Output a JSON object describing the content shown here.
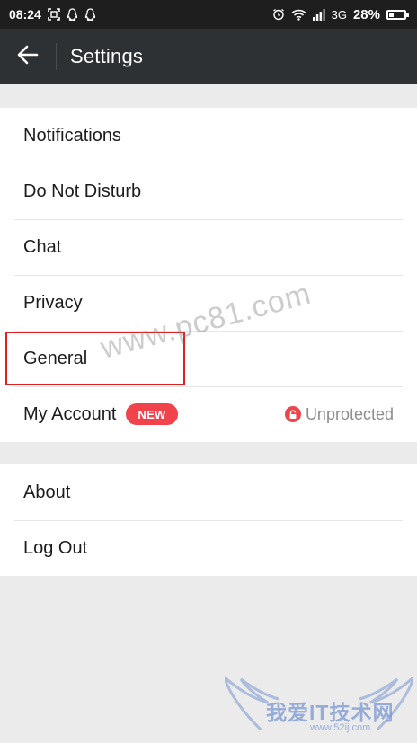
{
  "status_bar": {
    "time": "08:24",
    "network": "3G",
    "battery": "28%",
    "icons": [
      "screenshot-icon",
      "qq-icon",
      "qq-icon",
      "alarm-icon",
      "wifi-icon",
      "signal-icon",
      "battery-icon"
    ]
  },
  "toolbar": {
    "title": "Settings",
    "back_icon": "arrow-left-icon"
  },
  "section1": {
    "items": [
      {
        "label": "Notifications"
      },
      {
        "label": "Do Not Disturb"
      },
      {
        "label": "Chat"
      },
      {
        "label": "Privacy"
      },
      {
        "label": "General",
        "highlighted": true
      },
      {
        "label": "My Account",
        "badge": "NEW",
        "status": "Unprotected",
        "status_icon": "lock-icon"
      }
    ]
  },
  "section2": {
    "items": [
      {
        "label": "About"
      },
      {
        "label": "Log Out"
      }
    ]
  },
  "watermarks": {
    "text": "www.pc81.com",
    "logo_text": "我爱IT技术网",
    "logo_url": "www.52ij.com"
  },
  "colors": {
    "toolbar": "#2e3133",
    "statusbar": "#1e1e1e",
    "badge": "#f0434b",
    "highlight": "#e0201f",
    "background": "#ebebeb"
  }
}
